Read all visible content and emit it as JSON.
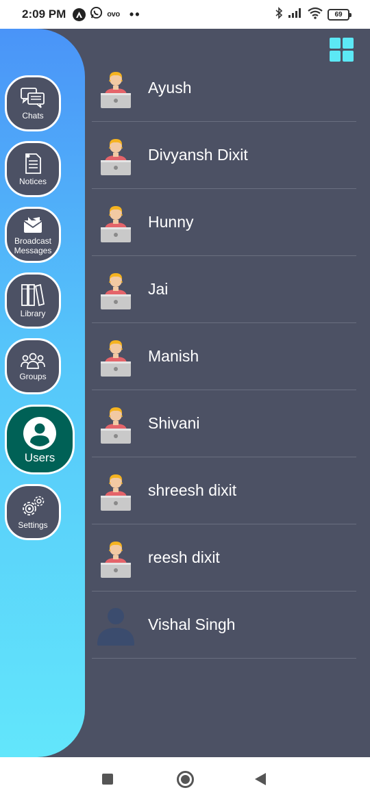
{
  "status_bar": {
    "time": "2:09 PM",
    "left_icons": [
      "a-icon",
      "whatsapp-icon",
      "ovo-icon"
    ],
    "ovo_text": "ovo",
    "dots": "••",
    "battery": "69",
    "right_icons": [
      "bluetooth-icon",
      "signal-icon",
      "wifi-icon",
      "battery-icon"
    ]
  },
  "sidebar": {
    "items": [
      {
        "label": "Chats",
        "icon": "chat-icon"
      },
      {
        "label": "Notices",
        "icon": "notice-icon"
      },
      {
        "label": "Broadcast\nMessages",
        "icon": "broadcast-icon"
      },
      {
        "label": "Library",
        "icon": "library-icon"
      },
      {
        "label": "Groups",
        "icon": "groups-icon"
      },
      {
        "label": "Users",
        "icon": "user-icon",
        "active": true
      },
      {
        "label": "Settings",
        "icon": "gear-icon"
      }
    ]
  },
  "header": {
    "grid_icon": "grid-view-icon",
    "grid_color": "#5ce8f5"
  },
  "users": [
    {
      "name": "Ayush",
      "avatar": "developer-avatar"
    },
    {
      "name": "Divyansh Dixit",
      "avatar": "developer-avatar"
    },
    {
      "name": "Hunny",
      "avatar": "developer-avatar"
    },
    {
      "name": "Jai",
      "avatar": "developer-avatar"
    },
    {
      "name": "Manish",
      "avatar": "developer-avatar"
    },
    {
      "name": "Shivani",
      "avatar": "developer-avatar"
    },
    {
      "name": "shreesh dixit",
      "avatar": "developer-avatar"
    },
    {
      "name": "reesh dixit",
      "avatar": "developer-avatar"
    },
    {
      "name": "Vishal Singh",
      "avatar": "default-person-avatar"
    }
  ],
  "colors": {
    "background": "#4c5164",
    "sidebar_gradient_top": "#4a94f8",
    "sidebar_gradient_bottom": "#62e6fb",
    "active_item": "#006156"
  },
  "nav_bar": {
    "buttons": [
      "recents-button",
      "home-button",
      "back-button"
    ]
  }
}
